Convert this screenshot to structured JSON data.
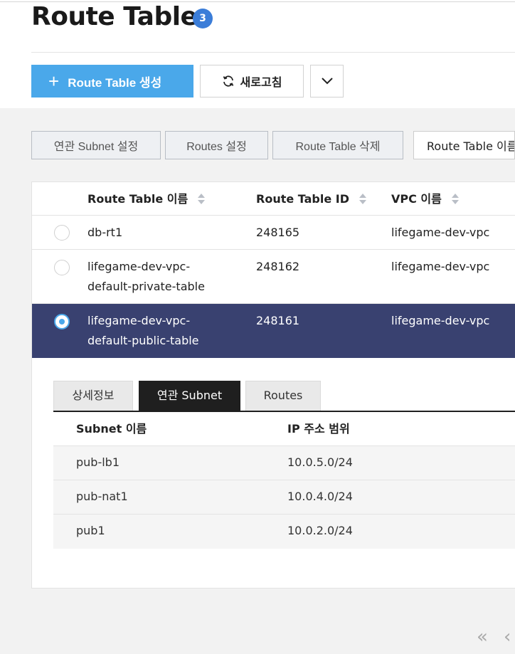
{
  "page": {
    "title": "Route Table",
    "count": "3"
  },
  "toolbar": {
    "create_label": "Route Table 생성",
    "create_icon": "plus-icon",
    "refresh_label": "새로고침",
    "refresh_icon": "refresh-icon",
    "more_icon": "chevron-down-icon"
  },
  "actions": {
    "subnet_settings": "연관 Subnet 설정",
    "routes_settings": "Routes 설정",
    "delete": "Route Table 삭제",
    "search_partial": "Route Table 이름"
  },
  "table": {
    "columns": [
      "Route Table 이름",
      "Route Table ID",
      "VPC 이름"
    ],
    "rows": [
      {
        "name_line1": "db-rt1",
        "name_line2": "",
        "id": "248165",
        "vpc": "lifegame-dev-vpc",
        "selected": false
      },
      {
        "name_line1": "lifegame-dev-vpc-",
        "name_line2": "default-private-table",
        "id": "248162",
        "vpc": "lifegame-dev-vpc",
        "selected": false
      },
      {
        "name_line1": "lifegame-dev-vpc-",
        "name_line2": "default-public-table",
        "id": "248161",
        "vpc": "lifegame-dev-vpc",
        "selected": true
      }
    ]
  },
  "detail": {
    "tabs": [
      "상세정보",
      "연관 Subnet",
      "Routes"
    ],
    "active_tab": 1,
    "subnet_columns": [
      "Subnet 이름",
      "IP 주소 범위"
    ],
    "subnets": [
      {
        "name": "pub-lb1",
        "cidr": "10.0.5.0/24"
      },
      {
        "name": "pub-nat1",
        "cidr": "10.0.4.0/24"
      },
      {
        "name": "pub1",
        "cidr": "10.0.2.0/24"
      }
    ]
  },
  "pagination": {
    "first": "«",
    "prev": "‹"
  },
  "colors": {
    "primary": "#4aa8ea",
    "selected_row": "#394170",
    "badge": "#3b7dd8"
  }
}
